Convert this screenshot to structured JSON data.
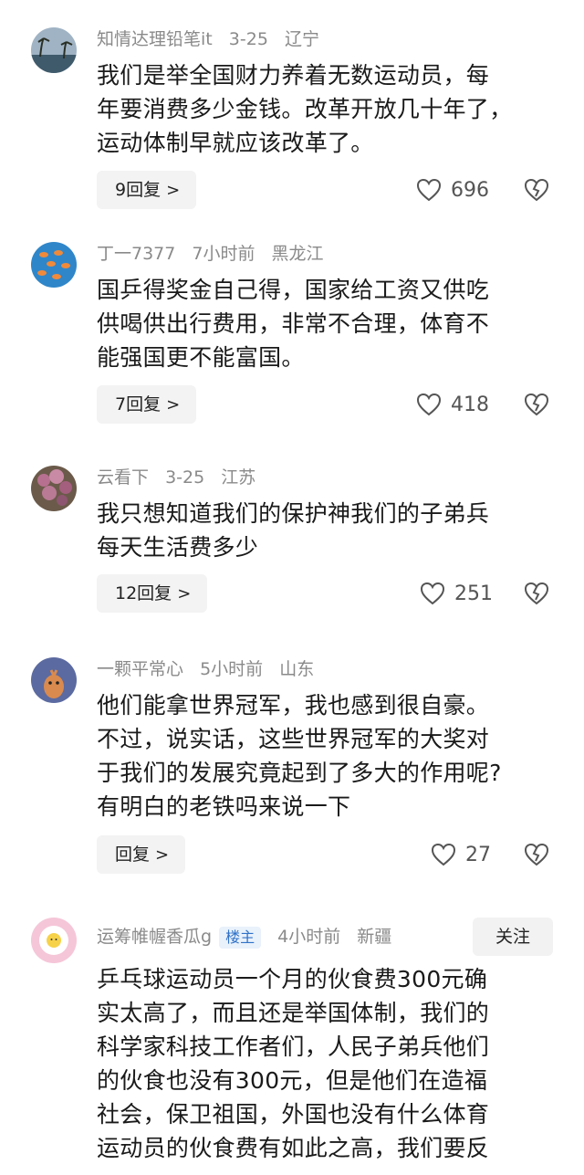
{
  "comments": [
    {
      "username": "知情达理铅笔it",
      "time": "3-25",
      "location": "辽宁",
      "lines": [
        "我们是举全国财力养着无数运动员，每",
        "年要消费多少金钱。改革开放几十年了，",
        "运动体制早就应该改革了。"
      ],
      "reply_label": "9回复",
      "likes": "696"
    },
    {
      "username": "丁一7377",
      "time": "7小时前",
      "location": "黑龙江",
      "lines": [
        "国乒得奖金自己得，国家给工资又供吃",
        "供喝供出行费用，非常不合理，体育不",
        "能强国更不能富国。"
      ],
      "reply_label": "7回复",
      "likes": "418"
    },
    {
      "username": "云看下",
      "time": "3-25",
      "location": "江苏",
      "lines": [
        "我只想知道我们的保护神我们的子弟兵",
        "每天生活费多少"
      ],
      "reply_label": "12回复",
      "likes": "251"
    },
    {
      "username": "一颗平常心",
      "time": "5小时前",
      "location": "山东",
      "lines": [
        "他们能拿世界冠军，我也感到很自豪。",
        "不过，说实话，这些世界冠军的大奖对",
        "于我们的发展究竟起到了多大的作用呢?",
        "有明白的老铁吗来说一下"
      ],
      "reply_label": "回复",
      "likes": "27"
    },
    {
      "username": "运筹帷幄香瓜g",
      "badge": "楼主",
      "time": "4小时前",
      "location": "新疆",
      "follow_label": "关注",
      "lines": [
        "乒乓球运动员一个月的伙食费300元确",
        "实太高了，而且还是举国体制，我们的",
        "科学家科技工作者们，人民子弟兵他们",
        "的伙食也没有300元，但是他们在造福",
        "社会，保卫祖国，外国也没有什么体育",
        "运动员的伙食费有如此之高，我们要反"
      ]
    }
  ],
  "icons": {
    "reply_chevron": "chevron-right-icon",
    "like": "heart-outline-icon",
    "dislike": "broken-heart-icon"
  },
  "colors": {
    "meta_text": "#8a8a8a",
    "badge_bg": "#e9f1fb",
    "badge_text": "#2f72c8",
    "button_bg": "#f3f3f3"
  }
}
